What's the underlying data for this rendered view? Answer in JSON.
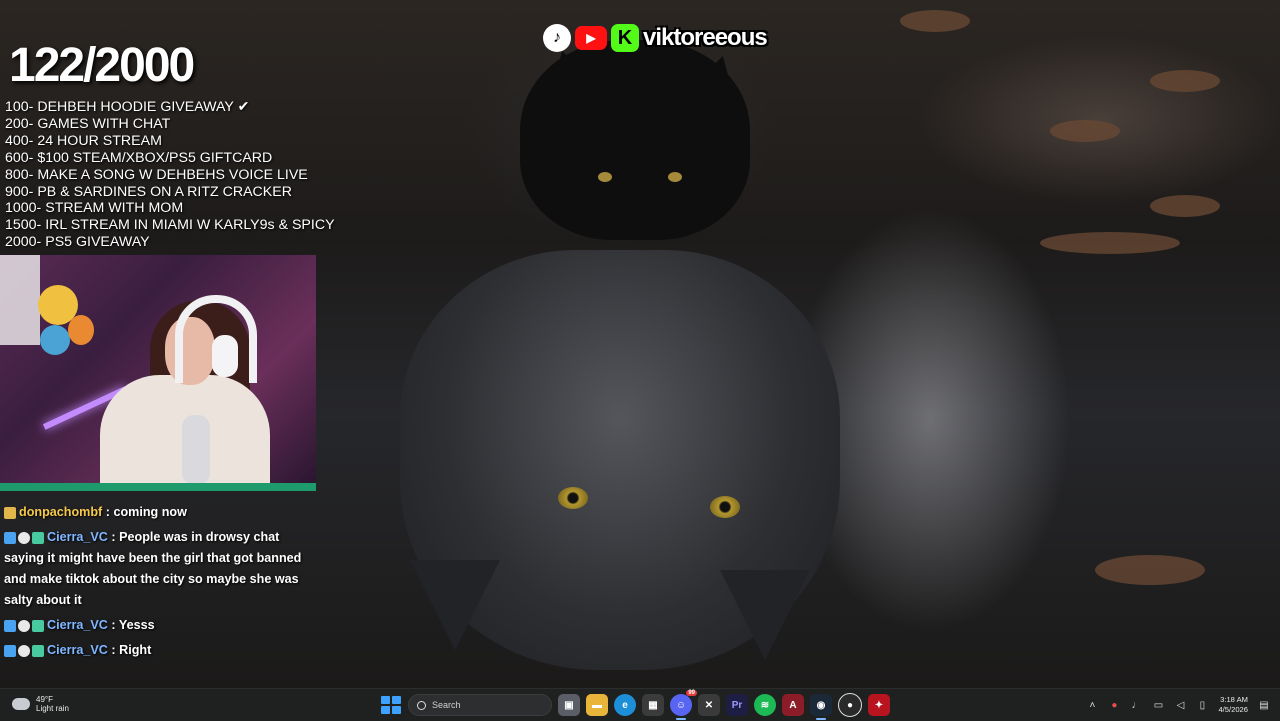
{
  "social": {
    "tiktok_icon": "tiktok-icon",
    "youtube_icon": "youtube-icon",
    "kick_icon": "kick-icon",
    "kick_letter": "K",
    "handle": "viktoreeous"
  },
  "goals": {
    "count": "122/2000",
    "items": [
      "100- DEHBEH HOODIE GIVEAWAY ✔",
      "200- GAMES WITH CHAT",
      "400- 24 HOUR STREAM",
      "600- $100 STEAM/XBOX/PS5 GIFTCARD",
      "800- MAKE A SONG W DEHBEHS VOICE LIVE",
      "900- PB & SARDINES ON A RITZ CRACKER",
      "1000- STREAM WITH MOM",
      "1500- IRL STREAM IN MIAMI W KARLY9s & SPICY",
      "2000- PS5 GIVEAWAY"
    ]
  },
  "chat": {
    "messages": [
      {
        "user": "donpachombf",
        "text": "coming now"
      },
      {
        "user": "Cierra_VC",
        "text": "People was in drowsy chat saying it might have been the girl that got banned and make tiktok about the city so maybe she was salty about it"
      },
      {
        "user": "Cierra_VC",
        "text": "Yesss"
      },
      {
        "user": "Cierra_VC",
        "text": "Right"
      }
    ],
    "separator": " : "
  },
  "taskbar": {
    "weather_temp": "49°F",
    "weather_desc": "Light rain",
    "search_placeholder": "Search",
    "discord_badge": "99",
    "clock_time": "3:18 AM",
    "clock_date": "4/5/2026",
    "colors": {
      "accent": "#3ea1ff",
      "background": "#1f2020"
    }
  }
}
